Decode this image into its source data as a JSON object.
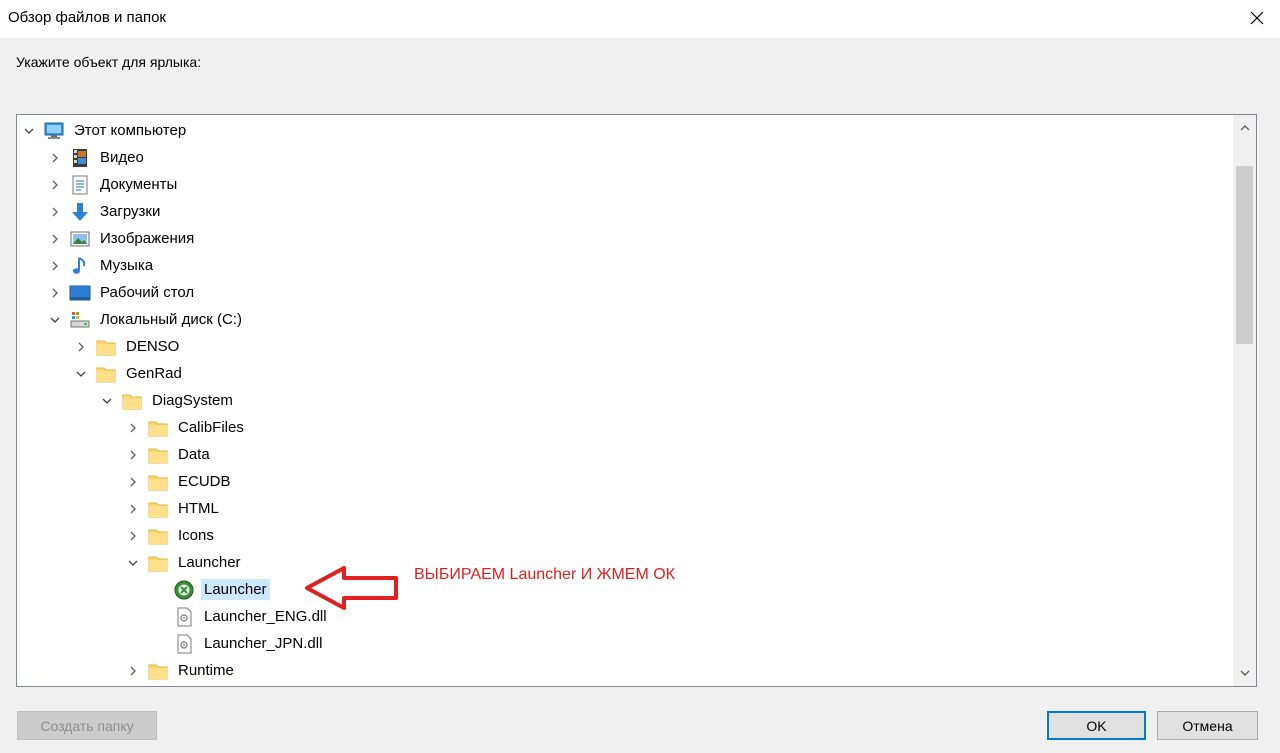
{
  "window": {
    "title": "Обзор файлов и папок",
    "close_glyph": "✕"
  },
  "prompt": "Укажите объект для ярлыка:",
  "tree": {
    "items": [
      {
        "label": "Этот компьютер",
        "icon": "computer-icon",
        "expander": "expanded"
      },
      {
        "label": "Видео",
        "icon": "video-folder-icon",
        "expander": "collapsed"
      },
      {
        "label": "Документы",
        "icon": "documents-folder-icon",
        "expander": "collapsed"
      },
      {
        "label": "Загрузки",
        "icon": "downloads-folder-icon",
        "expander": "collapsed"
      },
      {
        "label": "Изображения",
        "icon": "pictures-folder-icon",
        "expander": "collapsed"
      },
      {
        "label": "Музыка",
        "icon": "music-folder-icon",
        "expander": "collapsed"
      },
      {
        "label": "Рабочий стол",
        "icon": "desktop-folder-icon",
        "expander": "collapsed"
      },
      {
        "label": "Локальный диск (C:)",
        "icon": "local-disk-icon",
        "expander": "expanded"
      },
      {
        "label": "DENSO",
        "icon": "folder-icon",
        "expander": "collapsed"
      },
      {
        "label": "GenRad",
        "icon": "folder-icon",
        "expander": "expanded"
      },
      {
        "label": "DiagSystem",
        "icon": "folder-icon",
        "expander": "expanded"
      },
      {
        "label": "CalibFiles",
        "icon": "folder-icon",
        "expander": "collapsed"
      },
      {
        "label": "Data",
        "icon": "folder-icon",
        "expander": "collapsed"
      },
      {
        "label": "ECUDB",
        "icon": "folder-icon",
        "expander": "collapsed"
      },
      {
        "label": "HTML",
        "icon": "folder-icon",
        "expander": "collapsed"
      },
      {
        "label": "Icons",
        "icon": "folder-icon",
        "expander": "collapsed"
      },
      {
        "label": "Launcher",
        "icon": "folder-icon",
        "expander": "expanded"
      },
      {
        "label": "Launcher",
        "icon": "launcher-app-icon",
        "expander": "none",
        "selected": true
      },
      {
        "label": "Launcher_ENG.dll",
        "icon": "dll-file-icon",
        "expander": "none"
      },
      {
        "label": "Launcher_JPN.dll",
        "icon": "dll-file-icon",
        "expander": "none"
      },
      {
        "label": "Runtime",
        "icon": "folder-icon",
        "expander": "collapsed"
      }
    ]
  },
  "annotation": {
    "text": "ВЫБИРАЕМ Launcher И ЖМЕМ ОК",
    "color": "#e0201c"
  },
  "buttons": {
    "new_folder": "Создать папку",
    "ok": "OK",
    "cancel": "Отмена"
  },
  "colors": {
    "selection": "#cce8ff",
    "default_button_border": "#0078d7",
    "folder": "#ffd767"
  }
}
